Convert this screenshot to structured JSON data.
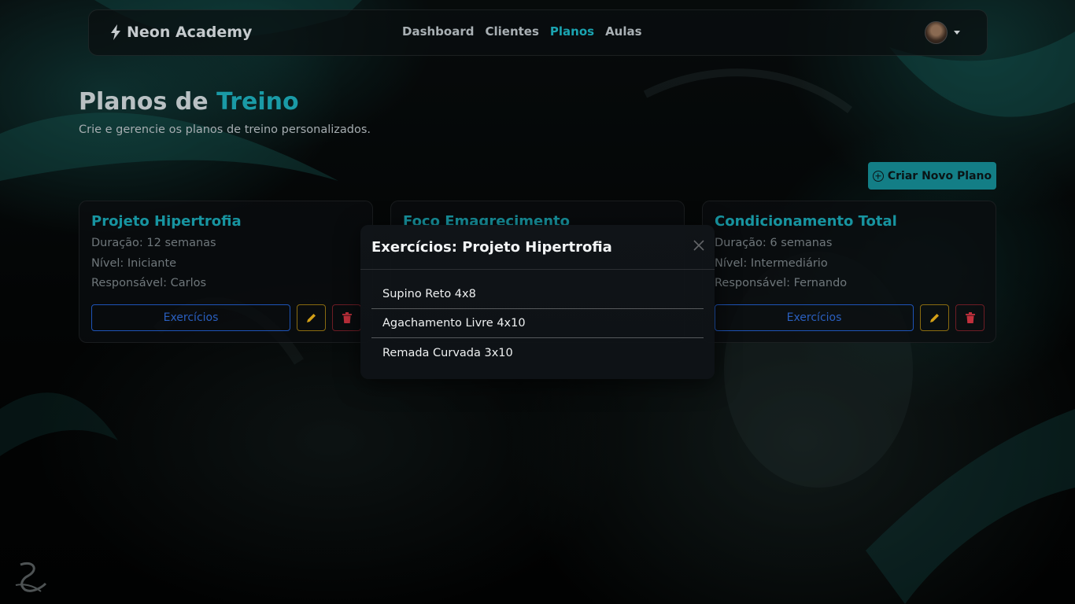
{
  "navbar": {
    "brand": "Neon Academy",
    "links": [
      {
        "label": "Dashboard",
        "active": false
      },
      {
        "label": "Clientes",
        "active": false
      },
      {
        "label": "Planos",
        "active": true
      },
      {
        "label": "Aulas",
        "active": false
      }
    ]
  },
  "header": {
    "title_part1": "Planos de",
    "title_part2": "Treino",
    "subtitle": "Crie e gerencie os planos de treino personalizados.",
    "create_button": "Criar Novo Plano"
  },
  "cards": [
    {
      "title": "Projeto Hipertrofia",
      "duration": "Duração: 12 semanas",
      "level": "Nível: Iniciante",
      "owner": "Responsável: Carlos",
      "exercises_button": "Exercícios"
    },
    {
      "title": "Foco Emagrecimento"
    },
    {
      "title": "Condicionamento Total",
      "duration": "Duração: 6 semanas",
      "level": "Nível: Intermediário",
      "owner": "Responsável: Fernando",
      "exercises_button": "Exercícios"
    }
  ],
  "modal": {
    "title": "Exercícios: Projeto Hipertrofia",
    "exercises": [
      "Supino Reto 4x8",
      "Agachamento Livre 4x10",
      "Remada Curvada 3x10"
    ]
  },
  "colors": {
    "accent": "#1a9aa6",
    "button_primary": "#137e86",
    "exercise_button": "#1e54b8",
    "edit": "#d4a017",
    "delete": "#c0303c"
  }
}
